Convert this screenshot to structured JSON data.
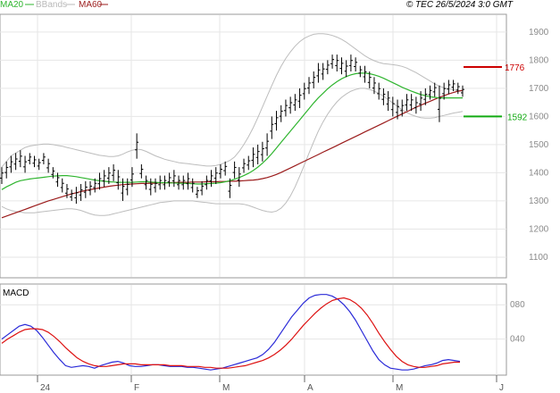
{
  "header": {
    "legend": [
      {
        "label": "MA20",
        "color": "#2fb52f"
      },
      {
        "label": "BBands",
        "color": "#b9b9b9"
      },
      {
        "label": "MA60",
        "color": "#9b1c1c"
      }
    ],
    "copyright": "© TEC 26/5/2024 3:0 GMT"
  },
  "chart_data": [
    {
      "type": "line",
      "title": "",
      "ylim": [
        1030,
        1960
      ],
      "yticks": [
        1100,
        1200,
        1300,
        1400,
        1500,
        1600,
        1700,
        1800,
        1900
      ],
      "ytick_labels": [
        "1100",
        "1200",
        "1300",
        "1400",
        "1500",
        "1600",
        "1700",
        "1800",
        "1900"
      ],
      "xticks": [
        "24",
        "F",
        "M",
        "A",
        "M",
        "J"
      ],
      "grid": true,
      "levels": [
        {
          "label": "1776",
          "value": 1776,
          "color": "#cc0000"
        },
        {
          "label": "1592",
          "value": 1600,
          "color": "#11aa11"
        }
      ],
      "price_bars": [
        [
          1360,
          1420
        ],
        [
          1380,
          1440
        ],
        [
          1400,
          1460
        ],
        [
          1410,
          1470
        ],
        [
          1420,
          1480
        ],
        [
          1400,
          1460
        ],
        [
          1430,
          1470
        ],
        [
          1420,
          1460
        ],
        [
          1410,
          1450
        ],
        [
          1430,
          1470
        ],
        [
          1400,
          1450
        ],
        [
          1380,
          1420
        ],
        [
          1350,
          1400
        ],
        [
          1330,
          1380
        ],
        [
          1310,
          1360
        ],
        [
          1300,
          1340
        ],
        [
          1290,
          1350
        ],
        [
          1300,
          1360
        ],
        [
          1310,
          1370
        ],
        [
          1320,
          1370
        ],
        [
          1330,
          1380
        ],
        [
          1340,
          1400
        ],
        [
          1350,
          1410
        ],
        [
          1360,
          1420
        ],
        [
          1370,
          1430
        ],
        [
          1340,
          1410
        ],
        [
          1300,
          1380
        ],
        [
          1320,
          1380
        ],
        [
          1350,
          1420
        ],
        [
          1450,
          1540
        ],
        [
          1380,
          1430
        ],
        [
          1340,
          1390
        ],
        [
          1320,
          1380
        ],
        [
          1330,
          1380
        ],
        [
          1340,
          1390
        ],
        [
          1340,
          1390
        ],
        [
          1350,
          1400
        ],
        [
          1350,
          1410
        ],
        [
          1340,
          1390
        ],
        [
          1340,
          1390
        ],
        [
          1340,
          1400
        ],
        [
          1330,
          1380
        ],
        [
          1310,
          1350
        ],
        [
          1320,
          1370
        ],
        [
          1340,
          1390
        ],
        [
          1350,
          1410
        ],
        [
          1360,
          1420
        ],
        [
          1380,
          1430
        ],
        [
          1390,
          1440
        ],
        [
          1310,
          1380
        ],
        [
          1380,
          1440
        ],
        [
          1350,
          1420
        ],
        [
          1400,
          1450
        ],
        [
          1410,
          1460
        ],
        [
          1420,
          1490
        ],
        [
          1430,
          1500
        ],
        [
          1440,
          1510
        ],
        [
          1460,
          1540
        ],
        [
          1520,
          1600
        ],
        [
          1550,
          1620
        ],
        [
          1580,
          1640
        ],
        [
          1600,
          1660
        ],
        [
          1610,
          1670
        ],
        [
          1620,
          1680
        ],
        [
          1630,
          1700
        ],
        [
          1660,
          1720
        ],
        [
          1680,
          1740
        ],
        [
          1700,
          1760
        ],
        [
          1720,
          1790
        ],
        [
          1730,
          1790
        ],
        [
          1750,
          1800
        ],
        [
          1770,
          1820
        ],
        [
          1760,
          1820
        ],
        [
          1750,
          1810
        ],
        [
          1740,
          1800
        ],
        [
          1760,
          1820
        ],
        [
          1760,
          1810
        ],
        [
          1740,
          1780
        ],
        [
          1720,
          1780
        ],
        [
          1700,
          1760
        ],
        [
          1680,
          1740
        ],
        [
          1660,
          1720
        ],
        [
          1640,
          1700
        ],
        [
          1620,
          1690
        ],
        [
          1600,
          1670
        ],
        [
          1590,
          1660
        ],
        [
          1600,
          1660
        ],
        [
          1620,
          1680
        ],
        [
          1620,
          1680
        ],
        [
          1610,
          1670
        ],
        [
          1620,
          1690
        ],
        [
          1640,
          1700
        ],
        [
          1660,
          1710
        ],
        [
          1670,
          1720
        ],
        [
          1580,
          1710
        ],
        [
          1660,
          1720
        ],
        [
          1680,
          1730
        ],
        [
          1690,
          1730
        ],
        [
          1680,
          1720
        ],
        [
          1670,
          1710
        ]
      ],
      "ma20": [
        1340,
        1350,
        1358,
        1366,
        1372,
        1375,
        1378,
        1380,
        1382,
        1384,
        1386,
        1388,
        1389,
        1390,
        1390,
        1388,
        1386,
        1383,
        1380,
        1377,
        1374,
        1372,
        1370,
        1368,
        1367,
        1366,
        1366,
        1366,
        1366,
        1367,
        1368,
        1368,
        1367,
        1366,
        1365,
        1365,
        1364,
        1364,
        1363,
        1363,
        1362,
        1361,
        1360,
        1360,
        1361,
        1362,
        1363,
        1365,
        1368,
        1372,
        1377,
        1383,
        1390,
        1398,
        1408,
        1420,
        1434,
        1450,
        1468,
        1488,
        1508,
        1528,
        1548,
        1568,
        1588,
        1608,
        1628,
        1648,
        1666,
        1682,
        1698,
        1712,
        1724,
        1734,
        1742,
        1748,
        1752,
        1754,
        1754,
        1752,
        1748,
        1743,
        1736,
        1728,
        1720,
        1712,
        1704,
        1697,
        1690,
        1684,
        1678,
        1674,
        1670,
        1668,
        1666,
        1666,
        1666,
        1666,
        1666,
        1666
      ],
      "ma60": [
        1240,
        1246,
        1252,
        1258,
        1264,
        1270,
        1276,
        1282,
        1288,
        1294,
        1300,
        1305,
        1310,
        1315,
        1320,
        1325,
        1329,
        1333,
        1337,
        1340,
        1343,
        1346,
        1349,
        1352,
        1354,
        1356,
        1358,
        1359,
        1360,
        1361,
        1362,
        1362,
        1363,
        1363,
        1364,
        1364,
        1365,
        1365,
        1366,
        1366,
        1366,
        1367,
        1367,
        1367,
        1368,
        1368,
        1368,
        1369,
        1369,
        1370,
        1370,
        1371,
        1372,
        1373,
        1374,
        1376,
        1379,
        1383,
        1388,
        1394,
        1401,
        1409,
        1417,
        1425,
        1433,
        1441,
        1449,
        1457,
        1465,
        1473,
        1481,
        1489,
        1497,
        1505,
        1513,
        1521,
        1529,
        1537,
        1545,
        1553,
        1561,
        1569,
        1577,
        1585,
        1593,
        1601,
        1609,
        1617,
        1625,
        1633,
        1640,
        1647,
        1654,
        1661,
        1668,
        1674,
        1680,
        1685,
        1690,
        1693
      ],
      "bb_upper": [
        1420,
        1440,
        1460,
        1470,
        1480,
        1490,
        1495,
        1498,
        1500,
        1502,
        1502,
        1500,
        1497,
        1494,
        1490,
        1486,
        1482,
        1478,
        1474,
        1470,
        1466,
        1462,
        1460,
        1458,
        1458,
        1460,
        1466,
        1474,
        1480,
        1484,
        1482,
        1476,
        1468,
        1460,
        1454,
        1448,
        1444,
        1440,
        1436,
        1434,
        1432,
        1430,
        1428,
        1426,
        1424,
        1424,
        1426,
        1430,
        1436,
        1444,
        1456,
        1476,
        1500,
        1528,
        1560,
        1596,
        1634,
        1672,
        1710,
        1746,
        1778,
        1806,
        1830,
        1850,
        1866,
        1878,
        1886,
        1892,
        1894,
        1894,
        1892,
        1888,
        1882,
        1874,
        1864,
        1852,
        1840,
        1828,
        1816,
        1806,
        1798,
        1792,
        1788,
        1786,
        1784,
        1782,
        1778,
        1772,
        1764,
        1756,
        1746,
        1736,
        1726,
        1716,
        1708,
        1702,
        1698,
        1695,
        1692,
        1690
      ],
      "bb_lower": [
        1280,
        1272,
        1266,
        1262,
        1260,
        1258,
        1258,
        1258,
        1260,
        1262,
        1264,
        1266,
        1268,
        1270,
        1272,
        1272,
        1270,
        1266,
        1260,
        1254,
        1250,
        1248,
        1248,
        1250,
        1254,
        1258,
        1262,
        1266,
        1270,
        1274,
        1278,
        1282,
        1286,
        1290,
        1294,
        1296,
        1298,
        1300,
        1300,
        1300,
        1300,
        1300,
        1298,
        1296,
        1294,
        1292,
        1290,
        1290,
        1290,
        1290,
        1290,
        1290,
        1288,
        1284,
        1278,
        1272,
        1266,
        1262,
        1260,
        1264,
        1274,
        1292,
        1318,
        1350,
        1388,
        1428,
        1470,
        1510,
        1548,
        1580,
        1608,
        1632,
        1652,
        1668,
        1680,
        1690,
        1696,
        1700,
        1700,
        1696,
        1690,
        1682,
        1672,
        1660,
        1648,
        1636,
        1624,
        1614,
        1606,
        1600,
        1596,
        1594,
        1594,
        1596,
        1600,
        1604,
        1608,
        1612,
        1615,
        1618
      ]
    },
    {
      "type": "line",
      "title": "MACD",
      "ylim": [
        0,
        100
      ],
      "yticks": [
        40,
        80
      ],
      "ytick_labels": [
        "040",
        "080"
      ],
      "xticks": [
        "24",
        "F",
        "M",
        "A",
        "M",
        "J"
      ],
      "grid": true,
      "series": [
        {
          "color": "#2a2ad8",
          "values": [
            40,
            45,
            50,
            55,
            57,
            55,
            50,
            42,
            33,
            24,
            16,
            9,
            7,
            8,
            9,
            8,
            6,
            9,
            11,
            13,
            14,
            12,
            9,
            8,
            8,
            9,
            10,
            10,
            9,
            8,
            8,
            8,
            7,
            7,
            6,
            5,
            4,
            5,
            6,
            8,
            10,
            12,
            14,
            16,
            18,
            22,
            28,
            36,
            46,
            56,
            66,
            74,
            82,
            88,
            91,
            92,
            92,
            90,
            86,
            80,
            72,
            62,
            50,
            38,
            26,
            16,
            10,
            6,
            5,
            4,
            4,
            5,
            7,
            9,
            10,
            12,
            15,
            16,
            15,
            14
          ]
        },
        {
          "color": "#dd1111",
          "values": [
            35,
            40,
            44,
            48,
            51,
            52,
            52,
            51,
            48,
            43,
            37,
            30,
            24,
            18,
            14,
            11,
            9,
            8,
            8,
            9,
            10,
            11,
            11,
            11,
            10,
            10,
            10,
            10,
            10,
            9,
            9,
            9,
            8,
            8,
            8,
            7,
            7,
            6,
            6,
            6,
            7,
            8,
            9,
            11,
            13,
            15,
            18,
            22,
            27,
            33,
            40,
            48,
            56,
            63,
            70,
            76,
            81,
            85,
            87,
            88,
            86,
            82,
            76,
            68,
            58,
            47,
            37,
            28,
            20,
            14,
            10,
            8,
            7,
            7,
            8,
            9,
            11,
            12,
            13,
            13
          ]
        }
      ]
    }
  ]
}
